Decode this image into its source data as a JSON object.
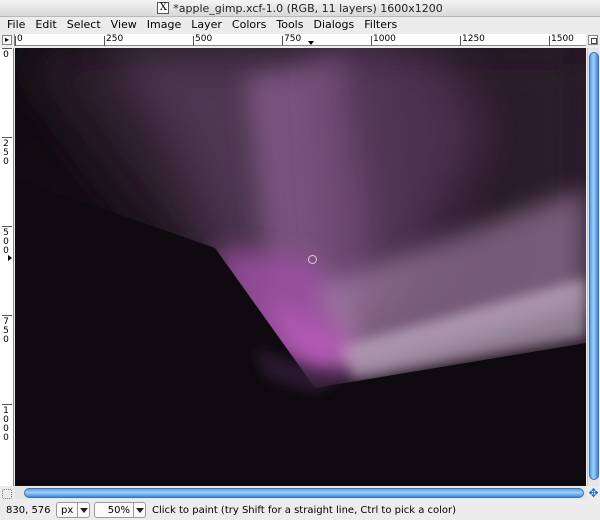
{
  "window": {
    "title": "*apple_gimp.xcf-1.0 (RGB, 11 layers) 1600x1200"
  },
  "menu": [
    "File",
    "Edit",
    "Select",
    "View",
    "Image",
    "Layer",
    "Colors",
    "Tools",
    "Dialogs",
    "Filters"
  ],
  "rulers": {
    "horizontal": [
      "0",
      "250",
      "500",
      "750",
      "1000",
      "1250",
      "1500"
    ],
    "vertical": [
      "0",
      "250",
      "500",
      "750",
      "1000"
    ]
  },
  "status": {
    "coords": "830, 576",
    "unit": "px",
    "zoom": "50%",
    "message": "Click to paint (try Shift for a straight line, Ctrl to pick a color)"
  },
  "colors": {
    "canvas_bg": "#0e0a0f",
    "aurora_purple": "#8a4a90",
    "scroll_accent": "#4d96e0"
  },
  "icons": {
    "window_icon": "x11-icon",
    "navigate": "four-arrow-navigate-icon",
    "quick_mask": "quick-mask-icon"
  }
}
